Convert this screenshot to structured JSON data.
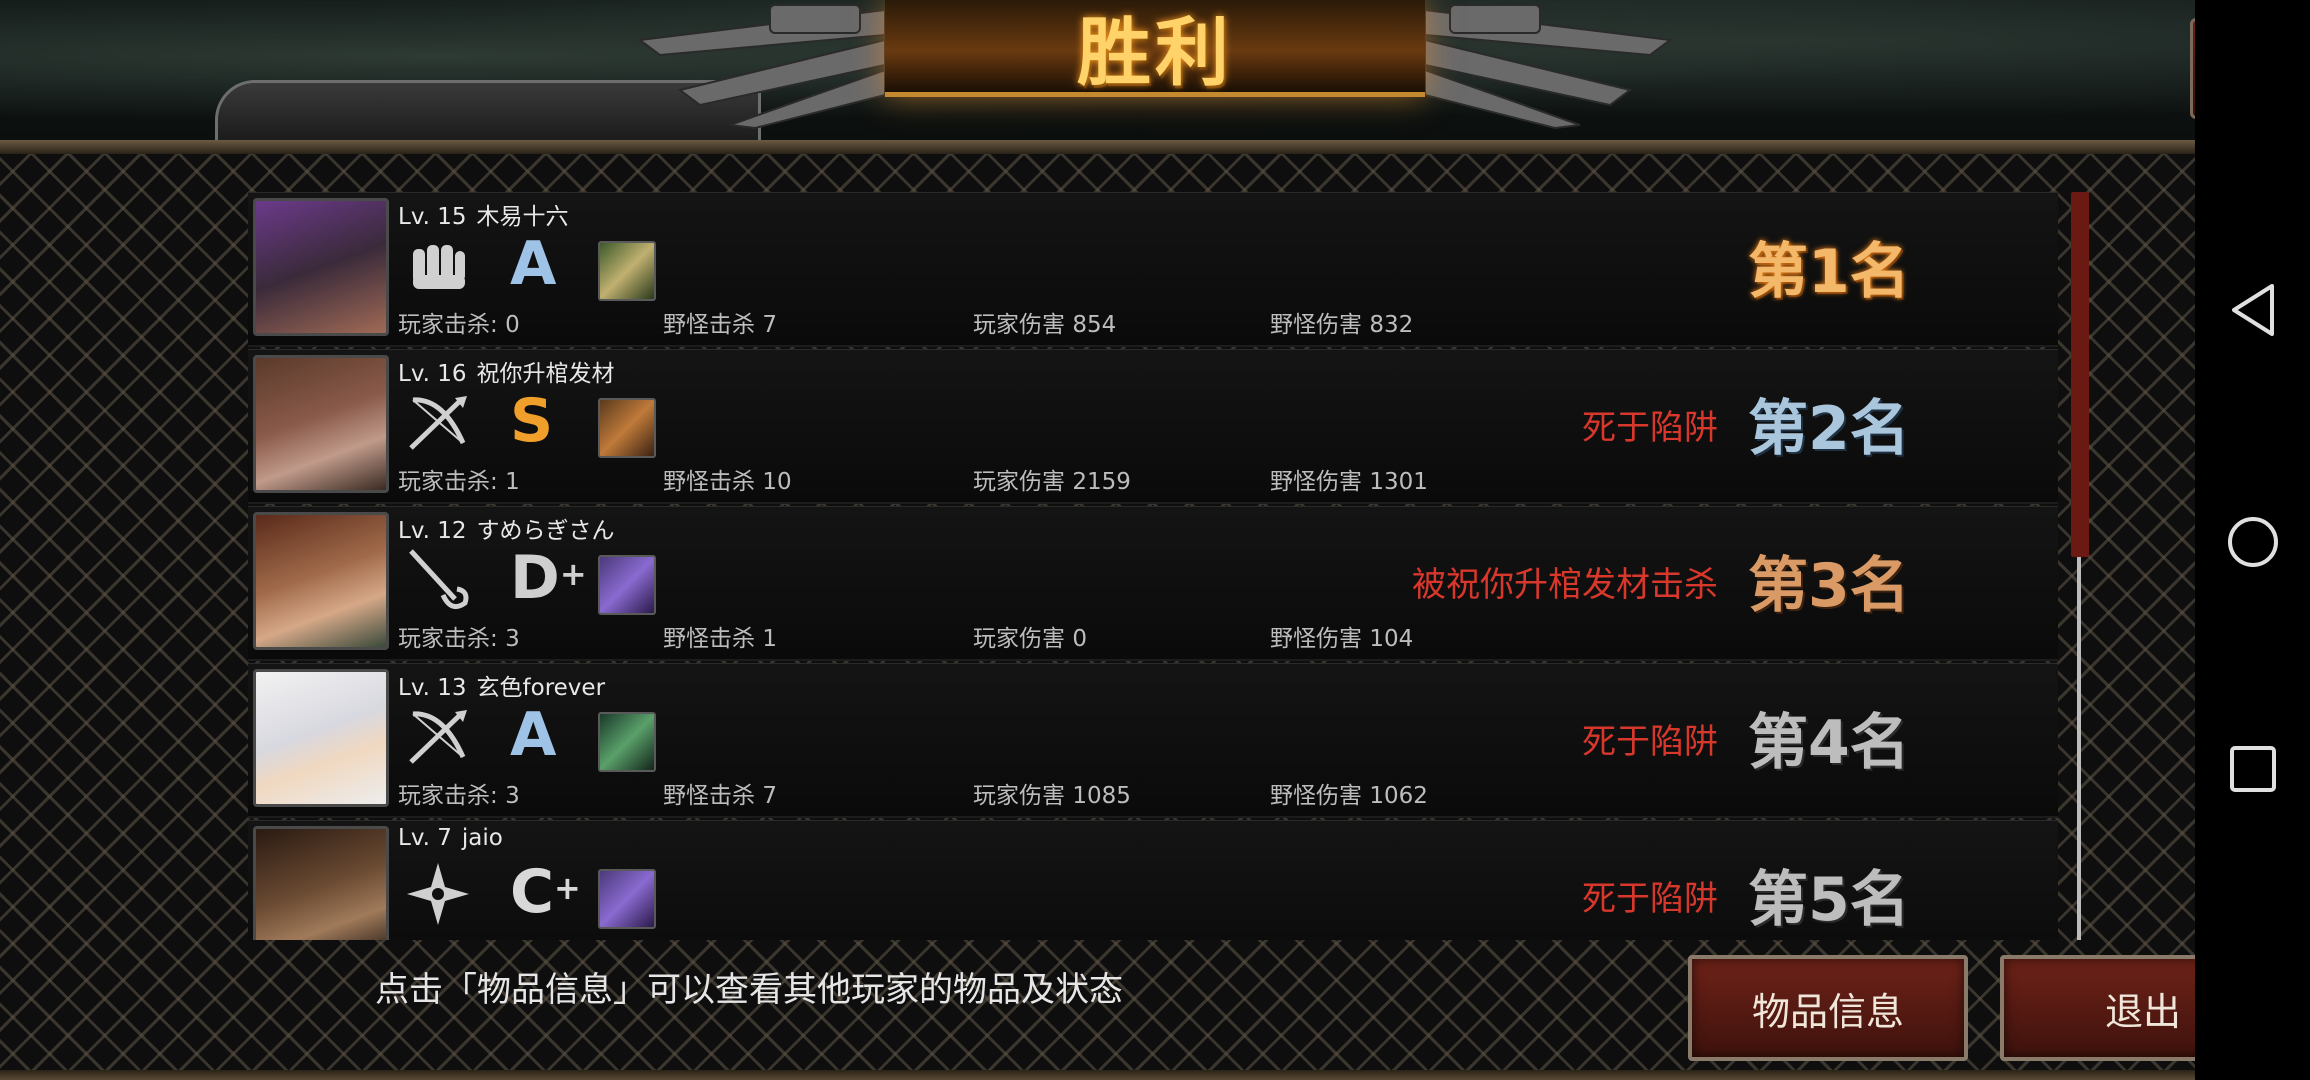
{
  "header": {
    "title": "胜利"
  },
  "hint": "点击「物品信息」可以查看其他玩家的物品及状态",
  "buttons": {
    "item_info": "物品信息",
    "exit": "退出"
  },
  "labels": {
    "player_kills": "玩家击杀:",
    "monster_kills": "野怪击杀",
    "player_damage": "玩家伤害",
    "monster_damage": "野怪伤害"
  },
  "players": [
    {
      "level": "Lv. 15",
      "name": "木易十六",
      "weapon_icon": "fist-icon",
      "grade": "A",
      "grade_plus": "",
      "grade_color": "#9fc3e6",
      "item_color": "#3d5a2a",
      "player_kills": "0",
      "monster_kills": "7",
      "player_damage": "854",
      "monster_damage": "832",
      "death": "",
      "rank": "第1名"
    },
    {
      "level": "Lv. 16",
      "name": "祝你升棺发材",
      "weapon_icon": "bow-icon",
      "grade": "S",
      "grade_plus": "",
      "grade_color": "#f0a02a",
      "item_color": "#5a3a1c",
      "player_kills": "1",
      "monster_kills": "10",
      "player_damage": "2159",
      "monster_damage": "1301",
      "death": "死于陷阱",
      "rank": "第2名"
    },
    {
      "level": "Lv. 12",
      "name": "すめらぎさん",
      "weapon_icon": "rapier-icon",
      "grade": "D",
      "grade_plus": "+",
      "grade_color": "#cfcfcf",
      "item_color": "#4a3a7a",
      "player_kills": "3",
      "monster_kills": "1",
      "player_damage": "0",
      "monster_damage": "104",
      "death": "被祝你升棺发材击杀",
      "rank": "第3名"
    },
    {
      "level": "Lv. 13",
      "name": "玄色forever",
      "weapon_icon": "bow-icon",
      "grade": "A",
      "grade_plus": "",
      "grade_color": "#9fc3e6",
      "item_color": "#2a5a3a",
      "player_kills": "3",
      "monster_kills": "7",
      "player_damage": "1085",
      "monster_damage": "1062",
      "death": "死于陷阱",
      "rank": "第4名"
    },
    {
      "level": "Lv. 7",
      "name": "jaio",
      "weapon_icon": "shuriken-icon",
      "grade": "C",
      "grade_plus": "+",
      "grade_color": "#d8d8d8",
      "item_color": "#4a3a7a",
      "player_kills": "",
      "monster_kills": "",
      "player_damage": "",
      "monster_damage": "",
      "death": "死于陷阱",
      "rank": "第5名"
    }
  ],
  "icons": {
    "share": "share-icon",
    "nav_back": "back-triangle-icon",
    "nav_home": "home-circle-icon",
    "nav_recents": "recents-square-icon"
  }
}
